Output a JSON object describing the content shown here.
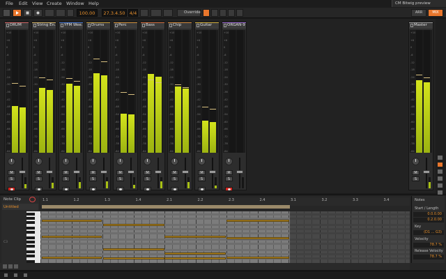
{
  "menu": [
    "File",
    "Edit",
    "View",
    "Create",
    "Window",
    "Help"
  ],
  "project_tab": "CM Bitwig preview",
  "transport": {
    "tempo": "100.00",
    "position": "27.3.4.50",
    "time_signature": "4/4",
    "override_label": "Override",
    "view_tabs": [
      "ARR",
      "MIX"
    ]
  },
  "mixer": {
    "scale_labels": [
      "+10",
      "+6",
      "0",
      "-6",
      "-12",
      "-18",
      "-24",
      "-30",
      "-36",
      "-42",
      "-48",
      "-54",
      "-60",
      "-66",
      "-72",
      "-78",
      "-84"
    ],
    "channels": [
      {
        "name": "DRUM",
        "color": "#d46a6a",
        "level": 0.38,
        "peak": 0.56,
        "fader": 0.55,
        "armed": true
      },
      {
        "name": "String En...",
        "color": "#d4b46a",
        "level": 0.53,
        "peak": 0.61,
        "fader": 0.55,
        "armed": false
      },
      {
        "name": "YFM Wee...",
        "color": "#4a7ad4",
        "level": 0.56,
        "peak": 0.6,
        "fader": 0.55,
        "armed": false
      },
      {
        "name": "Drums",
        "color": "#c8a040",
        "level": 0.65,
        "peak": 0.76,
        "fader": 0.55,
        "armed": false
      },
      {
        "name": "Perc",
        "color": "#d49440",
        "level": 0.32,
        "peak": 0.49,
        "fader": 0.55,
        "armed": false
      },
      {
        "name": "Bass",
        "color": "#d47040",
        "level": 0.64,
        "peak": 0.59,
        "fader": 0.55,
        "armed": false
      },
      {
        "name": "Chip",
        "color": "#d48c40",
        "level": 0.54,
        "peak": 0.55,
        "fader": 0.55,
        "armed": false
      },
      {
        "name": "Guitar",
        "color": "#d4b040",
        "level": 0.26,
        "peak": 0.37,
        "fader": 0.55,
        "armed": false
      },
      {
        "name": "ORGAN-9",
        "color": "#9c6ad4",
        "level": 0.0,
        "peak": 0.0,
        "fader": 0.55,
        "armed": true
      }
    ],
    "master": {
      "name": "Master",
      "level": 0.59,
      "peak": 0.63,
      "fader": 0.55
    },
    "mute_label": "M",
    "solo_label": "S"
  },
  "editor": {
    "clip_panel": {
      "title": "Note Clip",
      "clip_name": "Untitled"
    },
    "ruler_labels": [
      "1.1",
      "1.2",
      "1.3",
      "1.4",
      "2.1",
      "2.2",
      "2.3",
      "2.4",
      "3.1",
      "3.2",
      "3.3",
      "3.4"
    ],
    "notes_panel": {
      "title": "Notes",
      "start_length_label": "Start / Length",
      "start": "0.0.0.00",
      "length": "0.2.0.00",
      "key_label": "Key",
      "key": "(D1 ... G3)",
      "velocity_label": "Velocity",
      "velocity": "78.7 %",
      "release_label": "Release Velocity",
      "release": "78.7 %"
    }
  },
  "colors": {
    "accent": "#e8762c",
    "meter": "#c4d51a",
    "note": "#b8891f"
  }
}
